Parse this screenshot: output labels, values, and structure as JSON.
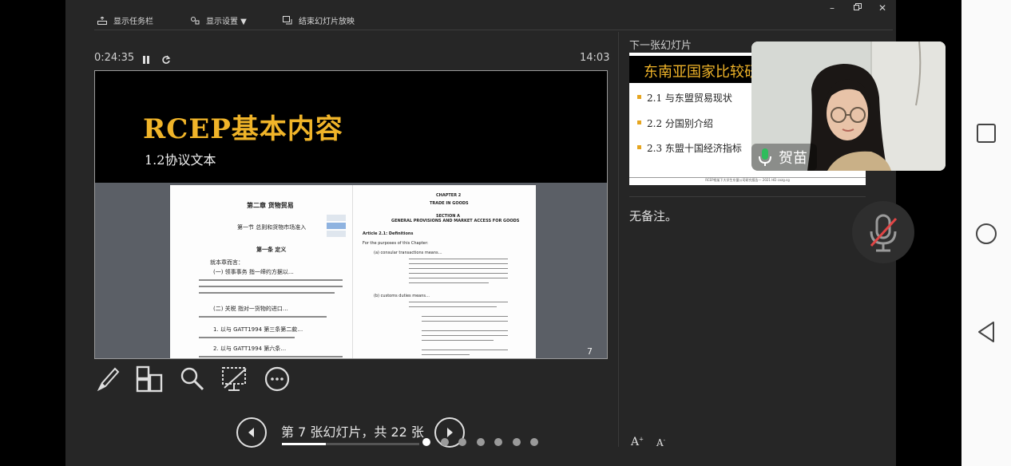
{
  "topbar": {
    "taskbar_label": "显示任务栏",
    "settings_label": "显示设置 ▼",
    "end_show_label": "结束幻灯片放映"
  },
  "timer": "0:24:35",
  "clock": "14:03",
  "current_slide": {
    "title": "RCEP基本内容",
    "subtitle": "1.2协议文本",
    "number": "7",
    "doc_left": {
      "chapter": "第二章  货物贸易",
      "section": "第一节  总则和货物市场准入",
      "article": "第一条  定义",
      "intro": "就本章而言：",
      "item1": "(一) 领事事务 指一缔约方据以…",
      "item2": "(二) 关税 指对一货物的进口…",
      "item3": "1. 以与 GATT1994 第三条第二款…",
      "item4": "2. 以与 GATT1994 第六条…"
    },
    "doc_right": {
      "chapter": "CHAPTER 2",
      "chapter_title": "TRADE IN GOODS",
      "section": "SECTION A",
      "section_title": "GENERAL PROVISIONS AND MARKET ACCESS FOR GOODS",
      "article": "Article 2.1: Definitions",
      "intro": "For the purposes of this Chapter:",
      "item_a": "(a)  consular transactions means…",
      "item_b": "(b)  customs duties means…"
    }
  },
  "toolbar": {
    "pen_icon": "pen-icon",
    "all_slides_icon": "grid-icon",
    "zoom_icon": "magnifier-icon",
    "black_screen_icon": "screen-slash-icon",
    "more_icon": "more-icon"
  },
  "navigation": {
    "counter": "第 7 张幻灯片，共 22 张",
    "progress_fraction": 0.32,
    "dot_count": 7,
    "active_dot": 0
  },
  "next_slide": {
    "label": "下一张幻灯片",
    "title": "东南亚国家比较研究",
    "bullets": [
      "2.1 与东盟贸易现状",
      "2.2 分国别介绍",
      "2.3 东盟十国经济指标"
    ],
    "footer": "RCEP框架下大学生东盟公司研究报告— 2021 HD cxzg.cg"
  },
  "notes": "无备注。",
  "video": {
    "participant_name": "贺苗"
  },
  "font_controls": {
    "increase": "A",
    "decrease": "A"
  },
  "colors": {
    "accent_gold": "#f0b429",
    "app_bg": "#262626"
  }
}
